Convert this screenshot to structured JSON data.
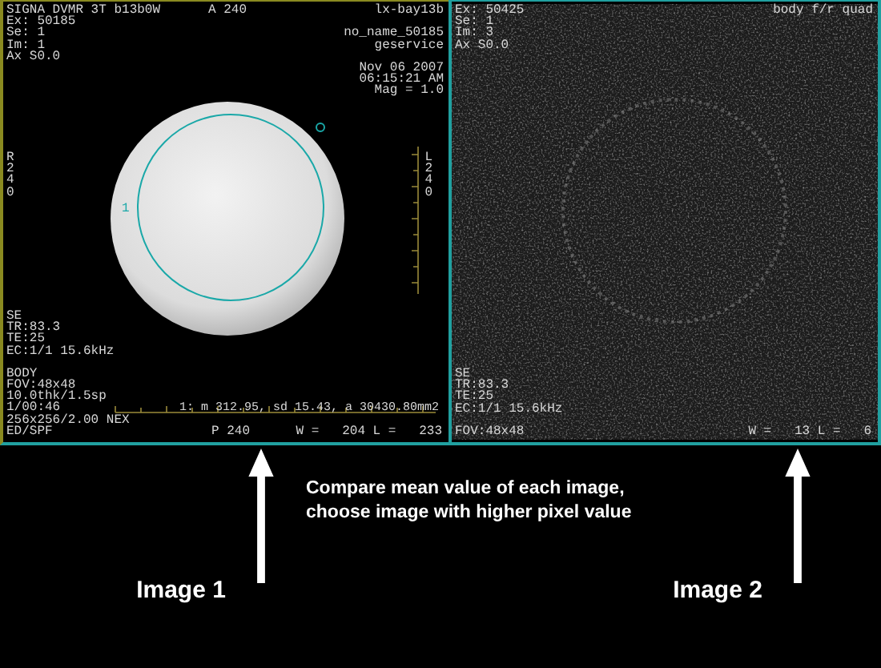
{
  "viewports": [
    {
      "kind": "phantom",
      "top_left": [
        "SIGNA DVMR 3T b13b0W",
        "Ex: 50185",
        "Se: 1",
        "Im: 1",
        "Ax S0.0"
      ],
      "top_center": "A 240",
      "top_right": [
        [
          "lx-bay13b"
        ],
        [
          "no_name_50185",
          "geservice"
        ],
        [
          "Nov 06 2007",
          "06:15:21 AM",
          "Mag = 1.0"
        ]
      ],
      "left_side": [
        "R",
        "2",
        "4",
        "0"
      ],
      "right_side": [
        "L",
        "2",
        "4",
        "0"
      ],
      "roi_label": "1",
      "sequence": [
        "SE",
        "TR:83.3",
        "TE:25",
        "EC:1/1 15.6kHz"
      ],
      "scan": [
        "BODY",
        "FOV:48x48",
        "10.0thk/1.5sp",
        "1/00:46",
        "256x256/2.00 NEX",
        "ED/SPF"
      ],
      "measurement": "1: m 312.95, sd 15.43, a 30430.80mm2",
      "bottom_center": "P 240",
      "window_level": "W =   204 L =   233"
    },
    {
      "kind": "noise",
      "top_left": [
        "Ex: 50425",
        "Se: 1",
        "Im: 3",
        "Ax S0.0"
      ],
      "top_right": [
        [
          "body f/r quad"
        ]
      ],
      "sequence": [
        "SE",
        "TR:83.3",
        "TE:25",
        "EC:1/1 15.6kHz"
      ],
      "scan": [
        "FOV:48x48"
      ],
      "window_level": "W =   13 L =   6"
    }
  ],
  "annotation": {
    "note": "Compare mean value of each image, choose image with higher pixel value",
    "labels": [
      "Image 1",
      "Image 2"
    ]
  }
}
